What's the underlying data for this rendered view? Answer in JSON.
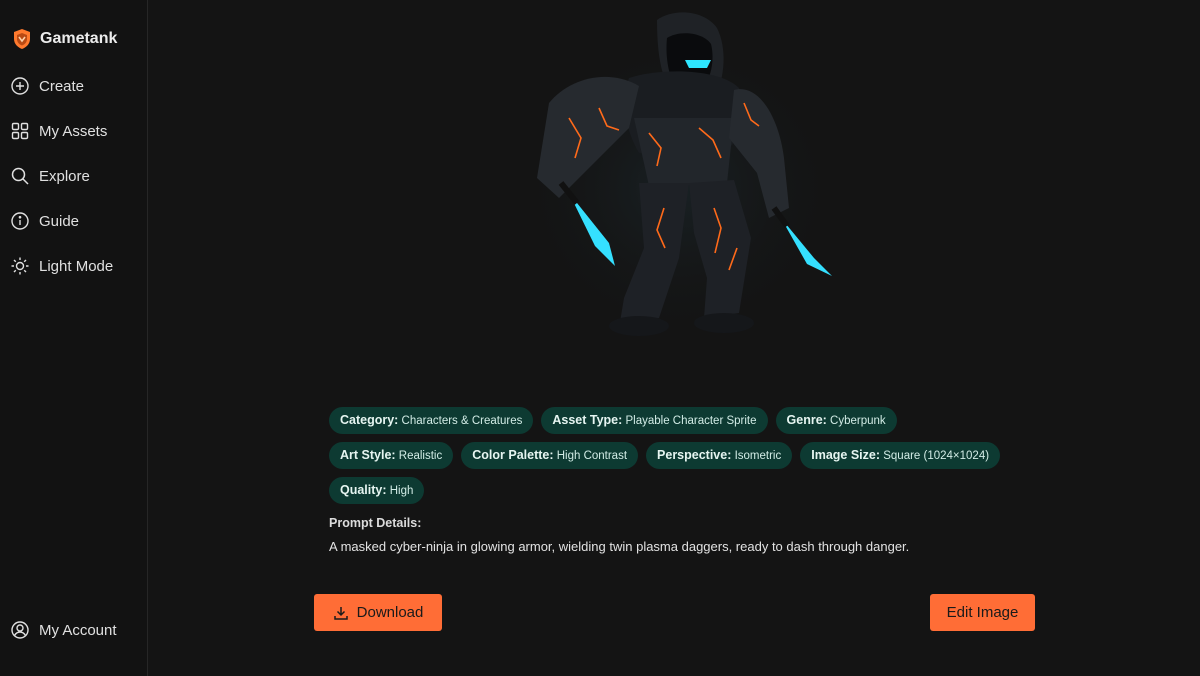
{
  "app": {
    "brand": "Gametank",
    "accent": "#ff6d36",
    "tag_bg": "#0d3a32"
  },
  "sidebar": {
    "items": [
      {
        "label": "Create",
        "icon": "plus-circle-icon"
      },
      {
        "label": "My Assets",
        "icon": "grid-icon"
      },
      {
        "label": "Explore",
        "icon": "search-icon"
      },
      {
        "label": "Guide",
        "icon": "info-icon"
      },
      {
        "label": "Light Mode",
        "icon": "sun-icon"
      }
    ],
    "account": {
      "label": "My Account",
      "icon": "user-circle-icon"
    }
  },
  "asset": {
    "image_subject": "cyber-ninja-sprite",
    "tags": [
      {
        "key": "Category:",
        "value": "Characters & Creatures"
      },
      {
        "key": "Asset Type:",
        "value": "Playable Character Sprite"
      },
      {
        "key": "Genre:",
        "value": "Cyberpunk"
      },
      {
        "key": "Art Style:",
        "value": "Realistic"
      },
      {
        "key": "Color Palette:",
        "value": "High Contrast"
      },
      {
        "key": "Perspective:",
        "value": "Isometric"
      },
      {
        "key": "Image Size:",
        "value": "Square (1024×1024)"
      },
      {
        "key": "Quality:",
        "value": "High"
      }
    ],
    "prompt_label": "Prompt Details:",
    "prompt_text": "A masked cyber-ninja in glowing armor, wielding twin plasma daggers, ready to dash through danger."
  },
  "actions": {
    "download_label": "Download",
    "edit_label": "Edit Image"
  }
}
